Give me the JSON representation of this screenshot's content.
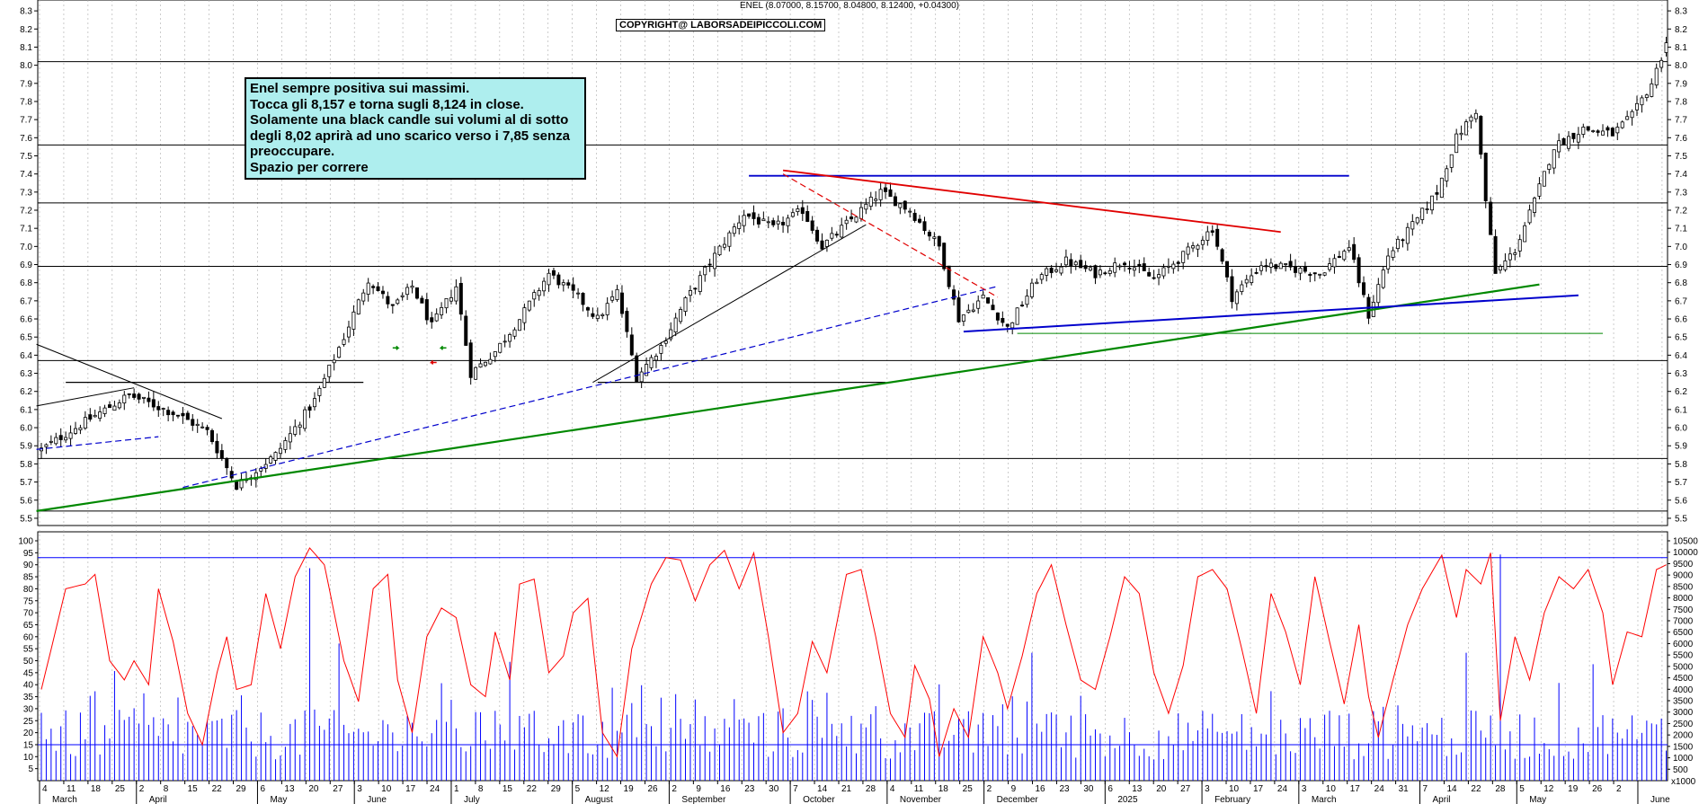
{
  "header": {
    "title": "ENEL (8.07000, 8.15700, 8.04800, 8.12400, +0.04300)",
    "copyright": "COPYRIGHT@ LABORSADEIPICCOLI.COM"
  },
  "note": {
    "lines": [
      "Enel sempre positiva sui massimi.",
      "Tocca gli 8,157 e torna sugli 8,124 in close.",
      "Solamente una black candle sui volumi al di sotto",
      "degli 8,02 aprirà ad uno scarico verso i 7,85 senza",
      "preoccupare.",
      "Spazio per correre"
    ]
  },
  "colors": {
    "candle": "#000000",
    "red_line": "#e00000",
    "blue_line": "#0000cc",
    "green_line": "#008800",
    "volume": "#0000ff",
    "oscillator": "#ff0000",
    "level": "#000000"
  },
  "chart_data": [
    {
      "type": "line",
      "series_kind": "candlestick",
      "symbol": "ENEL",
      "ylim": [
        5.46,
        8.36
      ],
      "yticks": [
        5.5,
        5.6,
        5.7,
        5.8,
        5.9,
        6.0,
        6.1,
        6.2,
        6.3,
        6.4,
        6.5,
        6.6,
        6.7,
        6.8,
        6.9,
        7.0,
        7.1,
        7.2,
        7.3,
        7.4,
        7.5,
        7.6,
        7.7,
        7.8,
        7.9,
        8.0,
        8.1,
        8.2,
        8.3
      ],
      "last": {
        "open": 8.07,
        "high": 8.157,
        "low": 8.048,
        "close": 8.124,
        "change": 0.043
      },
      "price_path": [
        [
          0,
          5.88
        ],
        [
          10,
          6.05
        ],
        [
          18,
          6.18
        ],
        [
          28,
          6.07
        ],
        [
          34,
          5.98
        ],
        [
          40,
          5.68
        ],
        [
          48,
          5.85
        ],
        [
          56,
          6.15
        ],
        [
          62,
          6.5
        ],
        [
          67,
          6.82
        ],
        [
          72,
          6.66
        ],
        [
          76,
          6.78
        ],
        [
          80,
          6.56
        ],
        [
          85,
          6.78
        ],
        [
          88,
          6.3
        ],
        [
          93,
          6.42
        ],
        [
          98,
          6.6
        ],
        [
          104,
          6.85
        ],
        [
          110,
          6.72
        ],
        [
          114,
          6.6
        ],
        [
          118,
          6.75
        ],
        [
          122,
          6.28
        ],
        [
          127,
          6.45
        ],
        [
          132,
          6.7
        ],
        [
          138,
          6.95
        ],
        [
          144,
          7.18
        ],
        [
          150,
          7.1
        ],
        [
          156,
          7.2
        ],
        [
          160,
          7.0
        ],
        [
          166,
          7.15
        ],
        [
          172,
          7.3
        ],
        [
          178,
          7.2
        ],
        [
          184,
          7.0
        ],
        [
          188,
          6.6
        ],
        [
          193,
          6.72
        ],
        [
          198,
          6.55
        ],
        [
          204,
          6.82
        ],
        [
          210,
          6.92
        ],
        [
          216,
          6.85
        ],
        [
          222,
          6.92
        ],
        [
          228,
          6.82
        ],
        [
          234,
          6.95
        ],
        [
          240,
          7.1
        ],
        [
          244,
          6.72
        ],
        [
          250,
          6.9
        ],
        [
          256,
          6.88
        ],
        [
          262,
          6.85
        ],
        [
          268,
          7.0
        ],
        [
          272,
          6.62
        ],
        [
          276,
          6.95
        ],
        [
          282,
          7.15
        ],
        [
          286,
          7.3
        ],
        [
          290,
          7.6
        ],
        [
          294,
          7.75
        ],
        [
          296,
          7.25
        ],
        [
          298,
          6.85
        ],
        [
          302,
          6.98
        ],
        [
          306,
          7.25
        ],
        [
          310,
          7.55
        ],
        [
          316,
          7.65
        ],
        [
          322,
          7.62
        ],
        [
          326,
          7.72
        ],
        [
          330,
          7.9
        ],
        [
          333,
          8.12
        ]
      ],
      "hlines": [
        5.54,
        5.83,
        6.37,
        6.89,
        7.24,
        7.56,
        8.02
      ],
      "support_box": {
        "from": 5,
        "to": 66,
        "level": 6.25
      },
      "annotations": [
        "Enel sempre positiva sui massimi."
      ]
    },
    {
      "type": "bar",
      "title": "",
      "volume_ylim": [
        0,
        10500
      ],
      "volume_ticks": [
        500,
        1000,
        1500,
        2000,
        2500,
        3000,
        3500,
        4000,
        4500,
        5000,
        5500,
        6000,
        6500,
        7000,
        7500,
        8000,
        8500,
        9000,
        9500,
        10000,
        10500
      ],
      "oscillator_ylim": [
        0,
        100
      ],
      "oscillator_ticks": [
        5,
        10,
        15,
        20,
        25,
        30,
        35,
        40,
        45,
        50,
        55,
        60,
        65,
        70,
        75,
        80,
        85,
        90,
        95,
        100
      ],
      "oscillator_levels": [
        15,
        93
      ],
      "oscillator_keys": [
        [
          0,
          38
        ],
        [
          5,
          80
        ],
        [
          9,
          82
        ],
        [
          11,
          86
        ],
        [
          14,
          50
        ],
        [
          17,
          42
        ],
        [
          19,
          50
        ],
        [
          22,
          40
        ],
        [
          24,
          80
        ],
        [
          27,
          58
        ],
        [
          30,
          28
        ],
        [
          33,
          15
        ],
        [
          36,
          45
        ],
        [
          38,
          60
        ],
        [
          40,
          38
        ],
        [
          43,
          40
        ],
        [
          46,
          78
        ],
        [
          49,
          55
        ],
        [
          52,
          85
        ],
        [
          55,
          97
        ],
        [
          58,
          90
        ],
        [
          62,
          50
        ],
        [
          65,
          33
        ],
        [
          68,
          80
        ],
        [
          71,
          86
        ],
        [
          73,
          42
        ],
        [
          76,
          20
        ],
        [
          79,
          60
        ],
        [
          82,
          72
        ],
        [
          85,
          68
        ],
        [
          88,
          40
        ],
        [
          91,
          35
        ],
        [
          93,
          62
        ],
        [
          96,
          42
        ],
        [
          98,
          82
        ],
        [
          101,
          84
        ],
        [
          104,
          45
        ],
        [
          107,
          52
        ],
        [
          109,
          70
        ],
        [
          112,
          76
        ],
        [
          115,
          20
        ],
        [
          118,
          10
        ],
        [
          121,
          55
        ],
        [
          125,
          82
        ],
        [
          128,
          93
        ],
        [
          131,
          92
        ],
        [
          134,
          75
        ],
        [
          137,
          90
        ],
        [
          140,
          96
        ],
        [
          143,
          80
        ],
        [
          146,
          95
        ],
        [
          149,
          60
        ],
        [
          152,
          20
        ],
        [
          155,
          28
        ],
        [
          158,
          58
        ],
        [
          161,
          45
        ],
        [
          165,
          86
        ],
        [
          168,
          88
        ],
        [
          171,
          60
        ],
        [
          174,
          28
        ],
        [
          177,
          18
        ],
        [
          179,
          48
        ],
        [
          182,
          34
        ],
        [
          184,
          10
        ],
        [
          187,
          30
        ],
        [
          190,
          18
        ],
        [
          193,
          60
        ],
        [
          196,
          45
        ],
        [
          198,
          30
        ],
        [
          201,
          52
        ],
        [
          204,
          78
        ],
        [
          207,
          90
        ],
        [
          210,
          65
        ],
        [
          213,
          42
        ],
        [
          216,
          38
        ],
        [
          219,
          60
        ],
        [
          222,
          85
        ],
        [
          225,
          78
        ],
        [
          228,
          45
        ],
        [
          231,
          28
        ],
        [
          234,
          48
        ],
        [
          237,
          85
        ],
        [
          240,
          88
        ],
        [
          243,
          80
        ],
        [
          246,
          55
        ],
        [
          249,
          28
        ],
        [
          252,
          78
        ],
        [
          255,
          62
        ],
        [
          258,
          40
        ],
        [
          261,
          85
        ],
        [
          264,
          58
        ],
        [
          267,
          32
        ],
        [
          270,
          65
        ],
        [
          272,
          35
        ],
        [
          274,
          18
        ],
        [
          277,
          42
        ],
        [
          280,
          65
        ],
        [
          283,
          80
        ],
        [
          287,
          94
        ],
        [
          290,
          68
        ],
        [
          292,
          88
        ],
        [
          295,
          82
        ],
        [
          297,
          95
        ],
        [
          299,
          25
        ],
        [
          302,
          60
        ],
        [
          305,
          42
        ],
        [
          308,
          70
        ],
        [
          311,
          85
        ],
        [
          314,
          80
        ],
        [
          317,
          88
        ],
        [
          320,
          70
        ],
        [
          322,
          40
        ],
        [
          325,
          62
        ],
        [
          328,
          60
        ],
        [
          331,
          88
        ],
        [
          333,
          90
        ]
      ],
      "volume_spikes": [
        [
          15,
          4800
        ],
        [
          55,
          9300
        ],
        [
          61,
          6000
        ],
        [
          96,
          5200
        ],
        [
          203,
          5600
        ],
        [
          292,
          5600
        ],
        [
          299,
          9900
        ],
        [
          318,
          5100
        ]
      ]
    }
  ],
  "x_axis": {
    "month_labels": [
      "March",
      "April",
      "May",
      "June",
      "July",
      "August",
      "September",
      "October",
      "November",
      "December",
      "2025",
      "February",
      "March",
      "April",
      "May",
      "June"
    ],
    "day_labels": [
      "4",
      "11",
      "18",
      "25",
      "2",
      "8",
      "15",
      "22",
      "29",
      "6",
      "13",
      "20",
      "27",
      "3",
      "10",
      "17",
      "24",
      "1",
      "8",
      "15",
      "22",
      "29",
      "5",
      "12",
      "19",
      "26",
      "2",
      "9",
      "16",
      "23",
      "30",
      "7",
      "14",
      "21",
      "28",
      "4",
      "11",
      "18",
      "25",
      "2",
      "9",
      "16",
      "23",
      "30",
      "6",
      "13",
      "20",
      "27",
      "3",
      "10",
      "17",
      "24",
      "3",
      "10",
      "17",
      "24",
      "31",
      "7",
      "14",
      "22",
      "28",
      "5",
      "12",
      "19",
      "26",
      "2"
    ],
    "volume_unit": "x1000"
  }
}
